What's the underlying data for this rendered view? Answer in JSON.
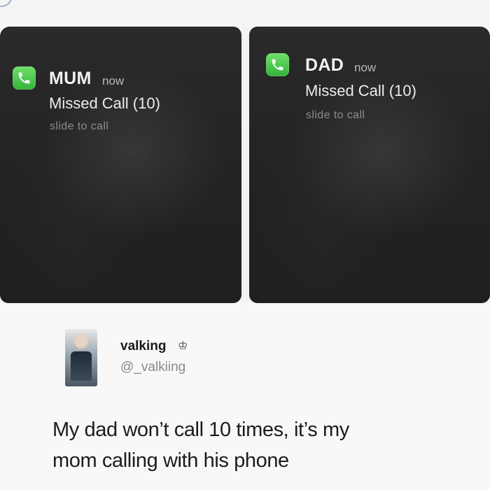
{
  "notifications": [
    {
      "caller": "MUM",
      "time": "now",
      "message": "Missed Call (10)",
      "action": "slide to call",
      "icon": "phone-icon"
    },
    {
      "caller": "DAD",
      "time": "now",
      "message": "Missed Call (10)",
      "action": "slide to call",
      "icon": "phone-icon"
    }
  ],
  "tweet": {
    "username": "valking",
    "badge_icon": "crown-icon",
    "handle": "@_valkiing",
    "text_line1": "My dad won’t call 10 times, it’s my",
    "text_line2": "mom calling with his phone"
  },
  "colors": {
    "phone_green": "#4cc94a",
    "panel_dark": "#242424",
    "background": "#f7f7f7"
  }
}
